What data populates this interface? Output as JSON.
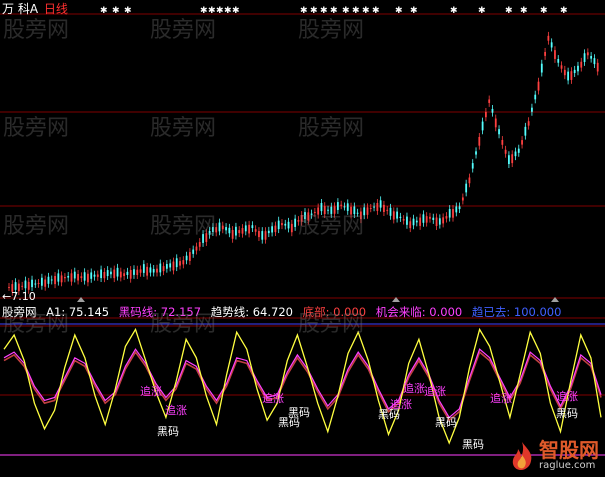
{
  "header": {
    "stock_name": "万 科A",
    "period": "日线"
  },
  "price_panel": {
    "low_label": "←7.10",
    "star_marker": "✱"
  },
  "indicator_bar": {
    "panel_name": "股旁网",
    "a1": "A1: 75.145",
    "heima": "黑码线: 72.157",
    "trend": "趋势线: 64.720",
    "bottom": "底部: 0.000",
    "chance": "机会来临: 0.000",
    "up": "趋已去: 100.000"
  },
  "signals": {
    "zhuizhang": "追涨",
    "heima": "黑码"
  },
  "watermarks": [
    "股旁网",
    "股旁网",
    "股旁网",
    "股旁网",
    "股旁网",
    "股旁网",
    "股旁网",
    "股旁网",
    "股旁网",
    "股旁网",
    "股旁网",
    "股旁网"
  ],
  "logo": {
    "name": "智股网",
    "url": "raglue.com"
  },
  "colors": {
    "background": "#000000",
    "up_candle": "#ff4040",
    "down_candle": "#54ffff",
    "a1_line": "#ffff40",
    "heima_line": "#ff40ff",
    "trend_line": "#c04040",
    "grid": "#800000"
  },
  "chart_data": {
    "type": "line",
    "price": {
      "low": 7.1,
      "closes": [
        7.2,
        7.3,
        7.4,
        7.5,
        7.7,
        7.8,
        7.9,
        7.8,
        7.9,
        8.0,
        8.1,
        8.0,
        8.1,
        8.3,
        8.2,
        8.4,
        8.6,
        8.8,
        9.4,
        10.2,
        10.8,
        11.0,
        10.6,
        10.8,
        11.0,
        10.4,
        10.8,
        11.2,
        11.0,
        11.6,
        11.8,
        12.2,
        12.0,
        12.4,
        12.1,
        11.8,
        12.2,
        12.4,
        11.9,
        11.6,
        11.2,
        11.4,
        11.6,
        11.3,
        11.8,
        12.2,
        14.0,
        16.5,
        19.0,
        17.0,
        15.2,
        15.8,
        17.6,
        20.0,
        23.0,
        21.5,
        20.5,
        21.0,
        22.0,
        21.2
      ]
    },
    "indicator": {
      "series": [
        {
          "name": "A1",
          "values": [
            78,
            88,
            70,
            40,
            22,
            35,
            65,
            88,
            72,
            45,
            25,
            50,
            80,
            92,
            70,
            48,
            30,
            55,
            85,
            72,
            45,
            25,
            60,
            90,
            78,
            50,
            28,
            40,
            70,
            88,
            65,
            40,
            20,
            45,
            75,
            90,
            70,
            42,
            18,
            35,
            68,
            85,
            60,
            30,
            12,
            30,
            65,
            92,
            80,
            55,
            30,
            60,
            90,
            75,
            40,
            20,
            55,
            88,
            72,
            30
          ]
        },
        {
          "name": "黑码线",
          "values": [
            70,
            74,
            66,
            50,
            40,
            42,
            56,
            70,
            66,
            52,
            40,
            46,
            64,
            76,
            66,
            52,
            42,
            50,
            68,
            64,
            50,
            40,
            52,
            70,
            68,
            54,
            42,
            44,
            60,
            72,
            62,
            48,
            36,
            44,
            62,
            74,
            64,
            48,
            34,
            40,
            58,
            70,
            58,
            40,
            28,
            34,
            56,
            76,
            70,
            56,
            42,
            54,
            74,
            68,
            50,
            36,
            50,
            72,
            66,
            44
          ]
        }
      ]
    }
  }
}
